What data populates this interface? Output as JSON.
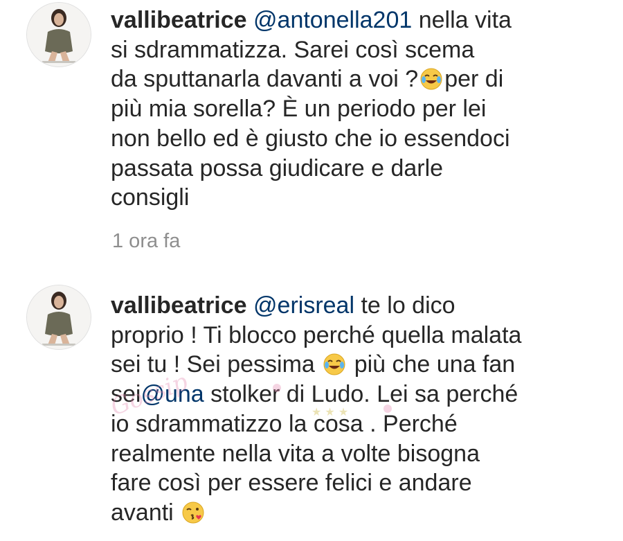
{
  "comments": [
    {
      "username": "vallibeatrice",
      "mention": "@antonella201",
      "line1_rest": " nella vita",
      "line2": "si sdrammatizza. Sarei così scema",
      "line3_before_emoji": "da sputtanarla davanti a voi ?",
      "line3_after_emoji": "per di",
      "line4": "più mia sorella? È un periodo per lei",
      "line5": "non bello ed è giusto che io essendoci",
      "line6": "passata possa giudicare e darle",
      "line7": "consigli",
      "timestamp": "1 ora fa",
      "emoji": "face-with-tears-of-joy"
    },
    {
      "username": "vallibeatrice",
      "mention": "@erisreal",
      "line1_rest": " te lo dico",
      "line2": "proprio ! Ti blocco perché quella malata",
      "line3_before_emoji": "sei tu ! Sei pessima ",
      "line3_after_emoji": " più che una fan",
      "line4_before_mention": "sei",
      "line4_mention": "@una",
      "line4_rest": " stolker di Ludo. Lei sa perché",
      "line5": "io sdrammatizzo la cosa . Perché",
      "line6": "realmente nella vita a volte bisogna",
      "line7": "fare così per essere felici e andare",
      "line8": "avanti ",
      "emoji_1": "face-with-tears-of-joy",
      "emoji_2": "face-blowing-a-kiss"
    }
  ],
  "colors": {
    "text": "#262626",
    "mention": "#003569",
    "timestamp": "#8e8e8e",
    "background": "#ffffff"
  },
  "watermark": "Gossip watermark"
}
